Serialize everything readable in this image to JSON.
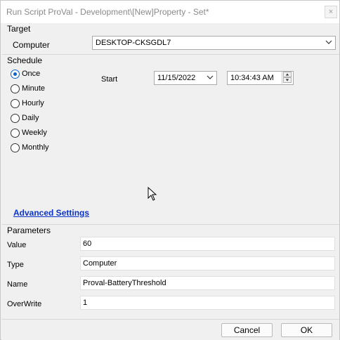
{
  "window": {
    "title": "Run Script ProVal - Development\\[New]Property - Set*",
    "close_glyph": "×"
  },
  "target": {
    "section": "Target",
    "computer_label": "Computer",
    "computer_value": "DESKTOP-CKSGDL7"
  },
  "schedule": {
    "section": "Schedule",
    "options": [
      "Once",
      "Minute",
      "Hourly",
      "Daily",
      "Weekly",
      "Monthly"
    ],
    "selected": "Once",
    "start_label": "Start",
    "start_date": "11/15/2022",
    "start_time": "10:34:43 AM"
  },
  "advanced": {
    "link_label": "Advanced Settings"
  },
  "parameters": {
    "section": "Parameters",
    "rows": [
      {
        "label": "Value",
        "value": "60"
      },
      {
        "label": "Type",
        "value": "Computer"
      },
      {
        "label": "Name",
        "value": "Proval-BatteryThreshold"
      },
      {
        "label": "OverWrite",
        "value": "1"
      }
    ]
  },
  "buttons": {
    "cancel": "Cancel",
    "ok": "OK"
  },
  "colors": {
    "accent": "#0a64c8",
    "link": "#0a33c8"
  },
  "icons": [
    "close-icon",
    "chevron-down-icon",
    "calendar-dropdown-icon",
    "spin-up-icon",
    "spin-down-icon",
    "mouse-cursor-icon"
  ]
}
